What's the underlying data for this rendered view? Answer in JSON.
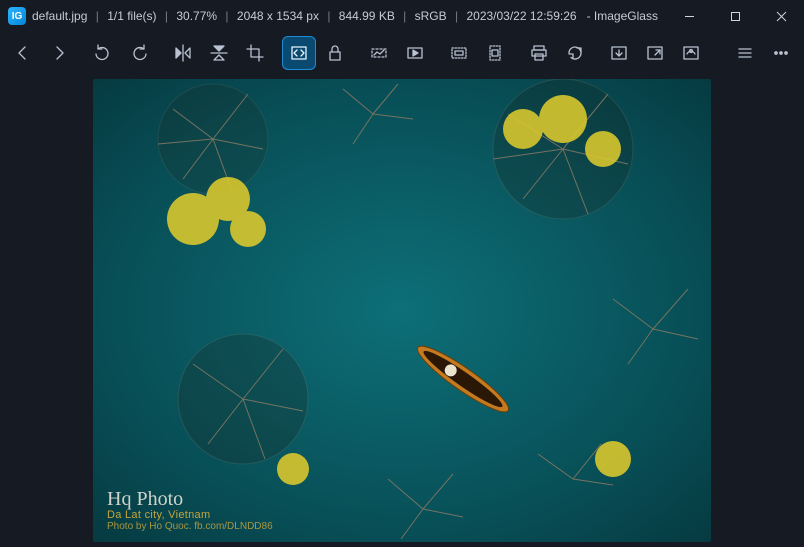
{
  "title": {
    "filename": "default.jpg",
    "file_position": "1/1 file(s)",
    "zoom": "30.77%",
    "dimensions": "2048 x 1534 px",
    "filesize": "844.99 KB",
    "colorspace": "sRGB",
    "datetime": "2023/03/22 12:59:26",
    "appname": "ImageGlass"
  },
  "window_controls": {
    "minimize": "Minimize",
    "maximize": "Maximize",
    "close": "Close"
  },
  "toolbar": {
    "nav_back": "Previous image",
    "nav_forward": "Next image",
    "undo": "Undo",
    "redo": "Redo",
    "flip_h": "Flip horizontal",
    "flip_v": "Flip vertical",
    "crop": "Crop",
    "fit_window": "Window fit",
    "lock_zoom": "Lock zoom",
    "panorama": "Panorama",
    "slideshow": "Slideshow",
    "gallery_h": "Horizontal gallery",
    "gallery_v": "Vertical gallery",
    "print": "Print",
    "refresh": "Refresh",
    "frame_nav": "Frame navigation",
    "fullscreen": "Fullscreen",
    "color_picker": "Color picker",
    "menu": "Main menu",
    "more": "More"
  },
  "image": {
    "watermark_signature": "Hq Photo",
    "watermark_line1": "Da Lat city, Vietnam",
    "watermark_line2": "Photo by Ho Quoc. fb.com/DLNDD86"
  }
}
